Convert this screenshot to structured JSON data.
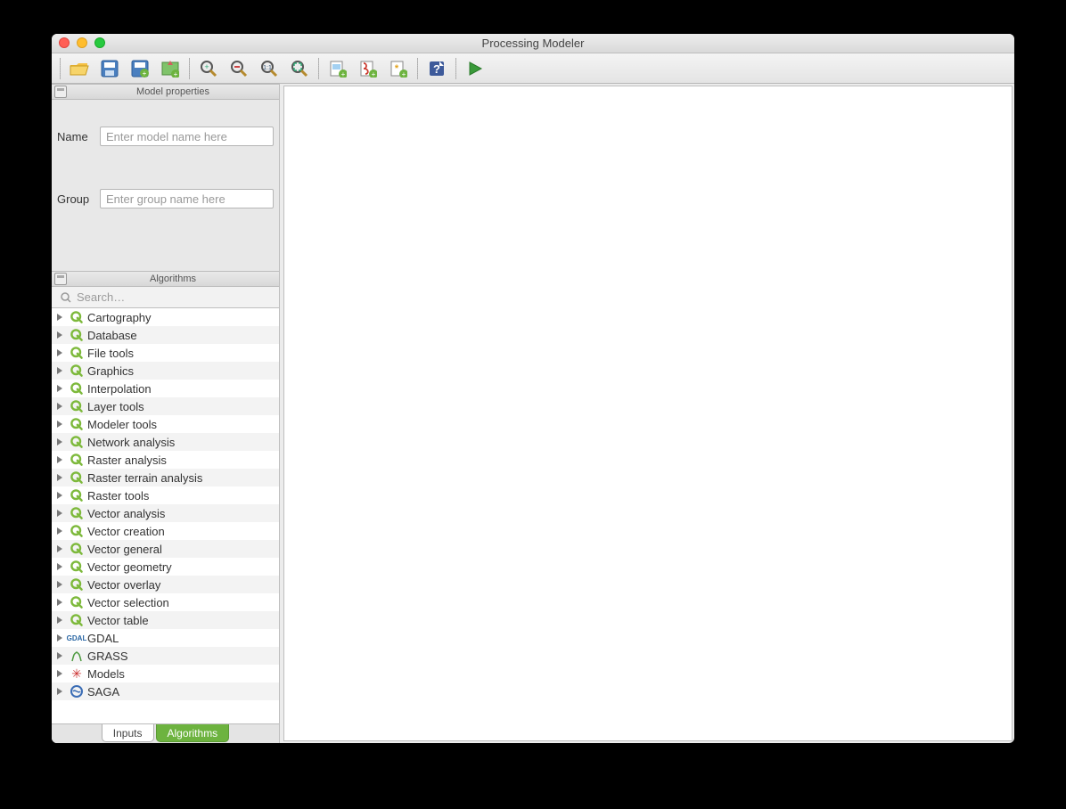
{
  "window": {
    "title": "Processing Modeler"
  },
  "toolbar": {
    "buttons": [
      {
        "name": "open",
        "sep_before": true
      },
      {
        "name": "save"
      },
      {
        "name": "save-as"
      },
      {
        "name": "add-to-project"
      },
      {
        "name": "zoom-in",
        "sep_before": true
      },
      {
        "name": "zoom-out"
      },
      {
        "name": "zoom-actual"
      },
      {
        "name": "zoom-full"
      },
      {
        "name": "export-image",
        "sep_before": true
      },
      {
        "name": "export-pdf"
      },
      {
        "name": "export-python"
      },
      {
        "name": "help",
        "sep_before": true
      },
      {
        "name": "run",
        "sep_before": true
      }
    ]
  },
  "panels": {
    "properties": {
      "title": "Model properties",
      "name_label": "Name",
      "name_placeholder": "Enter model name here",
      "name_value": "",
      "group_label": "Group",
      "group_placeholder": "Enter group name here",
      "group_value": ""
    },
    "algorithms": {
      "title": "Algorithms",
      "search_placeholder": "Search…",
      "search_value": ""
    }
  },
  "tabs": {
    "inputs": "Inputs",
    "algorithms": "Algorithms",
    "active": "algorithms"
  },
  "tree": [
    {
      "label": "Cartography",
      "icon": "qgis"
    },
    {
      "label": "Database",
      "icon": "qgis"
    },
    {
      "label": "File tools",
      "icon": "qgis"
    },
    {
      "label": "Graphics",
      "icon": "qgis"
    },
    {
      "label": "Interpolation",
      "icon": "qgis"
    },
    {
      "label": "Layer tools",
      "icon": "qgis"
    },
    {
      "label": "Modeler tools",
      "icon": "qgis"
    },
    {
      "label": "Network analysis",
      "icon": "qgis"
    },
    {
      "label": "Raster analysis",
      "icon": "qgis"
    },
    {
      "label": "Raster terrain analysis",
      "icon": "qgis"
    },
    {
      "label": "Raster tools",
      "icon": "qgis"
    },
    {
      "label": "Vector analysis",
      "icon": "qgis"
    },
    {
      "label": "Vector creation",
      "icon": "qgis"
    },
    {
      "label": "Vector general",
      "icon": "qgis"
    },
    {
      "label": "Vector geometry",
      "icon": "qgis"
    },
    {
      "label": "Vector overlay",
      "icon": "qgis"
    },
    {
      "label": "Vector selection",
      "icon": "qgis"
    },
    {
      "label": "Vector table",
      "icon": "qgis"
    },
    {
      "label": "GDAL",
      "icon": "gdal"
    },
    {
      "label": "GRASS",
      "icon": "grass"
    },
    {
      "label": "Models",
      "icon": "model"
    },
    {
      "label": "SAGA",
      "icon": "saga"
    }
  ]
}
